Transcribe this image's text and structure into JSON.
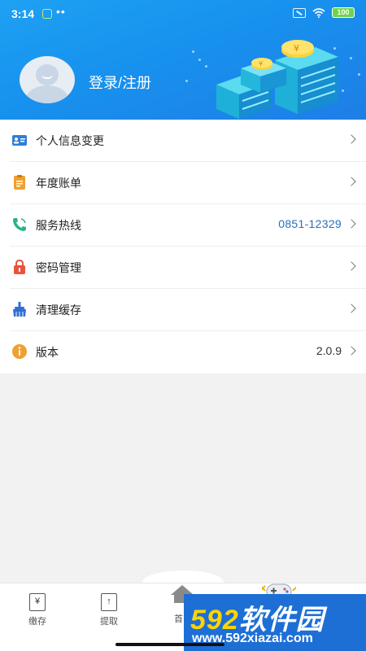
{
  "status_bar": {
    "time": "3:14",
    "dots": "••",
    "battery": "100"
  },
  "header": {
    "login_label": "登录/注册"
  },
  "menu": [
    {
      "label": "个人信息变更",
      "value": "",
      "icon": "id-card-icon",
      "color": "#2f7fd6"
    },
    {
      "label": "年度账单",
      "value": "",
      "icon": "bill-icon",
      "color": "#f0a030"
    },
    {
      "label": "服务热线",
      "value": "0851-12329",
      "icon": "phone-icon",
      "color": "#2bb38a"
    },
    {
      "label": "密码管理",
      "value": "",
      "icon": "lock-icon",
      "color": "#e8553f"
    },
    {
      "label": "清理缓存",
      "value": "",
      "icon": "broom-icon",
      "color": "#2f6fd6"
    },
    {
      "label": "版本",
      "value": "2.0.9",
      "icon": "info-icon",
      "color": "#f0a030"
    }
  ],
  "tabbar": {
    "tabs": [
      {
        "label": "缴存",
        "icon_text": "¥"
      },
      {
        "label": "提取",
        "icon_text": "↑"
      }
    ],
    "home_label": "首"
  },
  "watermark": {
    "brand_num": "592",
    "brand_text": "软件园",
    "url": "www.592xiazai.com"
  }
}
